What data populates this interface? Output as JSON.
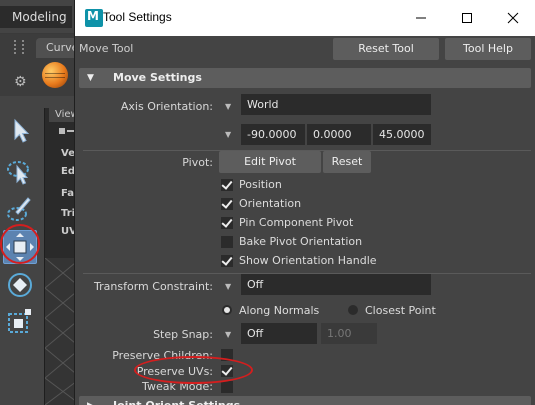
{
  "maya": {
    "menu_set": "Modeling",
    "shelf_tab": "Curve",
    "outliner_header": "View",
    "outliner_rows": [
      "Ve",
      "Ed",
      "Fa",
      "Tri",
      "UV"
    ]
  },
  "window": {
    "title": "Tool Settings",
    "app_icon_letter": "M"
  },
  "toolbar": {
    "tool_name": "Move Tool",
    "reset_tool_label": "Reset Tool",
    "tool_help_label": "Tool Help"
  },
  "move_settings": {
    "header": "Move Settings",
    "axis_orientation_label": "Axis Orientation:",
    "axis_orientation_value": "World",
    "axis_values": [
      "-90.0000",
      "0.0000",
      "45.0000"
    ],
    "pivot_label": "Pivot:",
    "edit_pivot_label": "Edit Pivot",
    "reset_label": "Reset",
    "pivot_options": [
      {
        "label": "Position",
        "checked": true
      },
      {
        "label": "Orientation",
        "checked": true
      },
      {
        "label": "Pin Component Pivot",
        "checked": true
      },
      {
        "label": "Bake Pivot Orientation",
        "checked": false
      },
      {
        "label": "Show Orientation Handle",
        "checked": true
      }
    ],
    "transform_constraint_label": "Transform Constraint:",
    "transform_constraint_value": "Off",
    "along_normals_label": "Along Normals",
    "closest_point_label": "Closest Point",
    "step_snap_label": "Step Snap:",
    "step_snap_value": "Off",
    "step_snap_amount": "1.00",
    "preserve_children_label": "Preserve Children:",
    "preserve_uvs_label": "Preserve UVs:",
    "tweak_mode_label": "Tweak Mode:",
    "preserve_children_checked": false,
    "preserve_uvs_checked": true,
    "tweak_mode_checked": false
  },
  "joint_orient": {
    "header": "Joint Orient Settings"
  },
  "colors": {
    "highlight_ring": "#d41e1e",
    "active_tool": "#5c83b0",
    "app_icon": "#0e92a8"
  }
}
